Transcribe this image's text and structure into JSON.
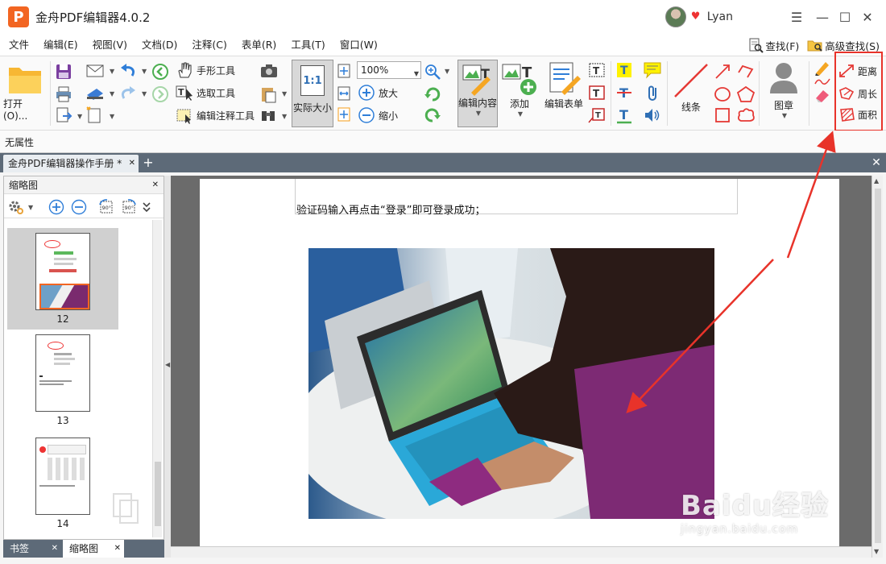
{
  "window": {
    "logo_letter": "P",
    "title": "金舟PDF编辑器4.0.2",
    "username": "Lyan",
    "controls": {
      "menu": "☰",
      "minimize": "—",
      "maximize": "☐",
      "close": "✕"
    }
  },
  "menubar": {
    "items": [
      "文件",
      "编辑(E)",
      "视图(V)",
      "文档(D)",
      "注释(C)",
      "表单(R)",
      "工具(T)",
      "窗口(W)"
    ],
    "find_label": "查找(F)",
    "advanced_find_label": "高级查找(S)"
  },
  "toolbar": {
    "open_label": "打开(O)...",
    "hand_tool": "手形工具",
    "select_text": "选取工具",
    "edit_annotation": "编辑注释工具",
    "actual_size_label": "实际大小",
    "actual_size_icon_text": "1:1",
    "zoom_value": "100%",
    "zoom_in": "放大",
    "zoom_out": "缩小",
    "edit_content": "编辑内容",
    "add": "添加",
    "edit_form": "编辑表单",
    "line": "线条",
    "stamp": "图章",
    "measure": {
      "distance": "距离",
      "perimeter": "周长",
      "area": "面积"
    }
  },
  "propbar": {
    "text": "无属性"
  },
  "tabs": {
    "document_tab": "金舟PDF编辑器操作手册 *"
  },
  "leftpanel": {
    "title": "缩略图",
    "rotate_left": "90°",
    "rotate_right": "90°",
    "thumbnails": [
      {
        "page": "12",
        "selected": true
      },
      {
        "page": "13",
        "selected": false
      },
      {
        "page": "14",
        "selected": false
      }
    ]
  },
  "bottom_tabs": {
    "bookmarks": "书签",
    "thumbnails": "缩略图"
  },
  "document": {
    "text_line": "验证码输入再点击“登录”即可登录成功；"
  },
  "watermark": {
    "main": "Baidu经验",
    "sub": "jingyan.baidu.com"
  },
  "colors": {
    "accent_red": "#e8332a",
    "tab_strip": "#5d6a78",
    "logo_orange": "#f26522"
  }
}
